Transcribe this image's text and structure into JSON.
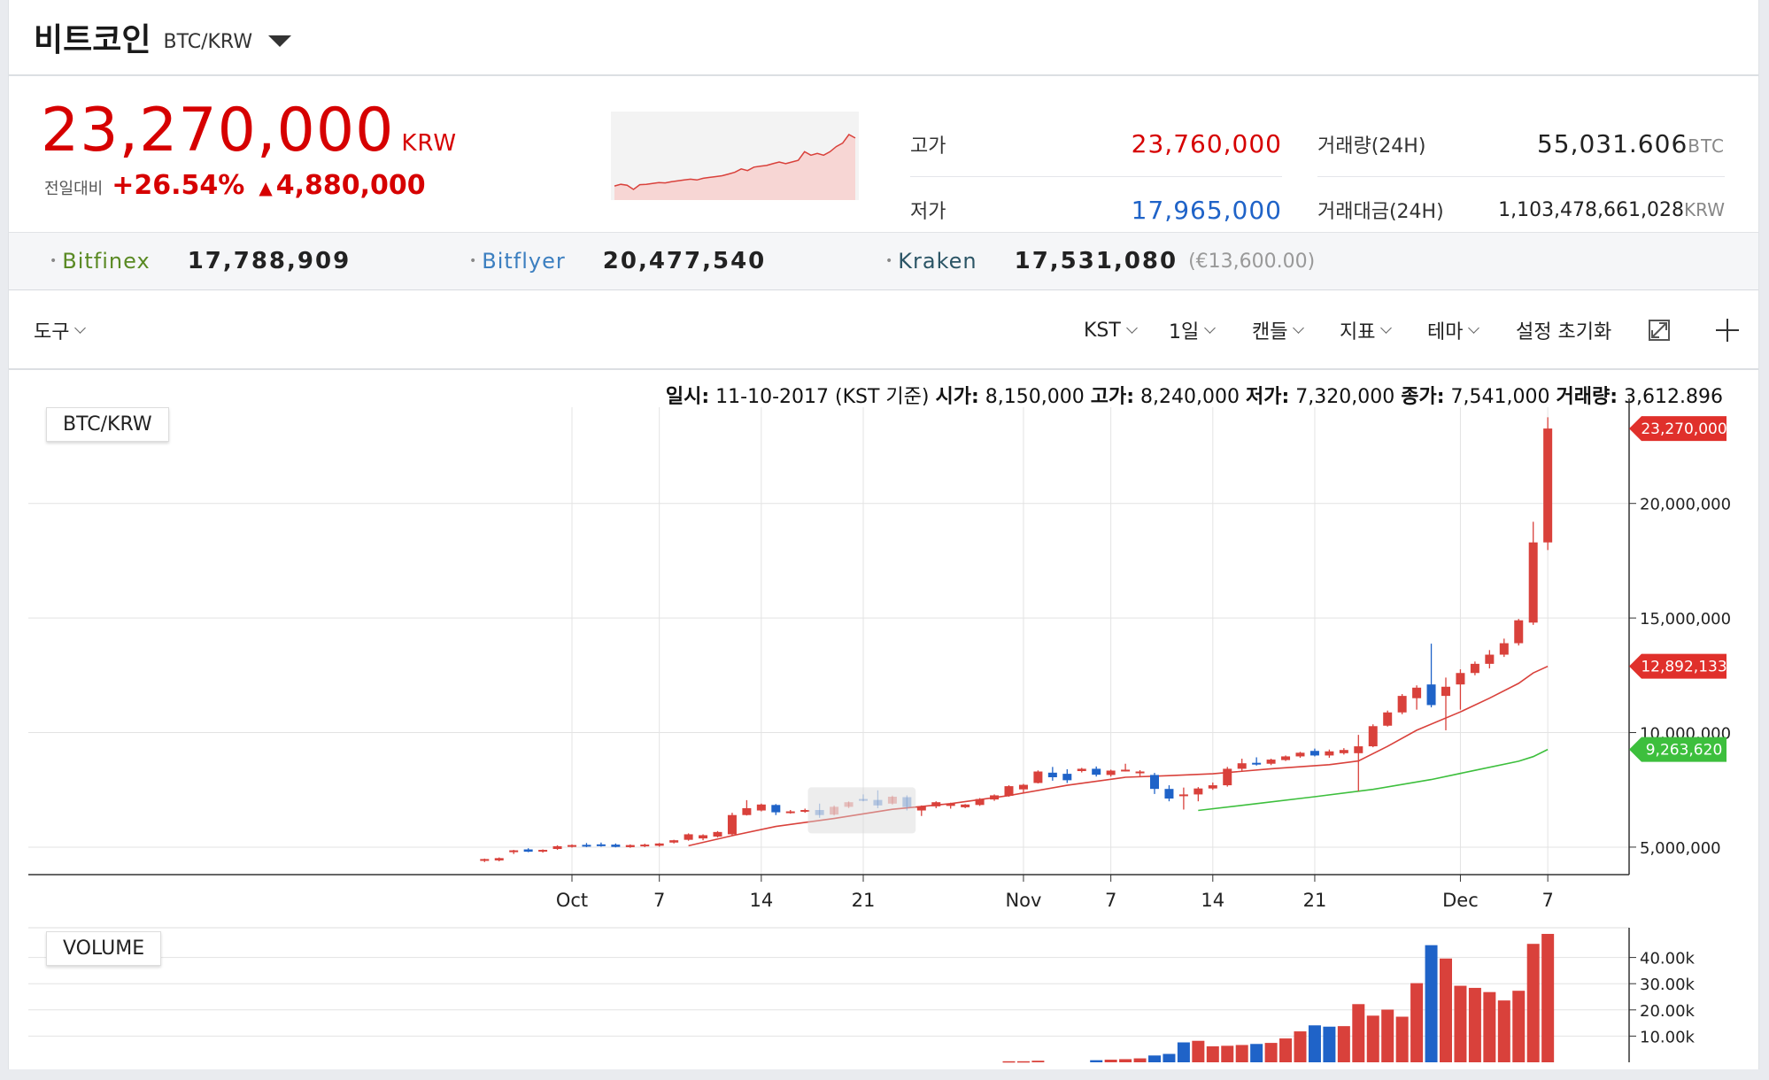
{
  "header": {
    "coin_name": "비트코인",
    "pair": "BTC/KRW"
  },
  "summary": {
    "price": "23,270,000",
    "price_unit": "KRW",
    "change_label": "전일대비",
    "change_pct": "+26.54%",
    "change_abs": "4,880,000",
    "high_label": "고가",
    "high_value": "23,760,000",
    "low_label": "저가",
    "low_value": "17,965,000",
    "volume_label": "거래량(24H)",
    "volume_value": "55,031.606",
    "volume_unit": "BTC",
    "amount_label": "거래대금(24H)",
    "amount_value": "1,103,478,661,028",
    "amount_unit": "KRW"
  },
  "exchanges": [
    {
      "name": "Bitfinex",
      "price": "17,788,909",
      "color": "#5a8a24",
      "extra": ""
    },
    {
      "name": "Bitflyer",
      "price": "20,477,540",
      "color": "#3c7fc0",
      "extra": ""
    },
    {
      "name": "Kraken",
      "price": "17,531,080",
      "color": "#2b5566",
      "extra": "(€13,600.00)"
    }
  ],
  "toolbar": {
    "tools": "도구",
    "timezone": "KST",
    "interval": "1일",
    "candle": "캔들",
    "indicator": "지표",
    "theme": "테마",
    "reset": "설정 초기화"
  },
  "info_line": {
    "date_label": "일시:",
    "date_value": "11-10-2017 (KST 기준)",
    "open_label": "시가:",
    "open_value": "8,150,000",
    "high_label": "고가:",
    "high_value": "8,240,000",
    "low_label": "저가:",
    "low_value": "7,320,000",
    "close_label": "종가:",
    "close_value": "7,541,000",
    "vol_label": "거래량:",
    "vol_value": "3,612.896"
  },
  "panels": {
    "price_label": "BTC/KRW",
    "volume_label": "VOLUME"
  },
  "colors": {
    "up": "#d9413b",
    "down": "#1f63c8",
    "ma_short": "#d9413b",
    "ma_long": "#3dbf3d",
    "price_red": "#d60000",
    "low_blue": "#1f63c8"
  },
  "chart_data": {
    "type": "candlestick",
    "ylim": [
      3800000,
      24200000
    ],
    "y_ticks": [
      5000000,
      10000000,
      15000000,
      20000000
    ],
    "y_tick_labels": [
      "5,000,000",
      "10,000,000",
      "15,000,000",
      "20,000,000"
    ],
    "x_ticks": [
      {
        "day": 0,
        "label": "Oct"
      },
      {
        "day": 6,
        "label": "7"
      },
      {
        "day": 13,
        "label": "14"
      },
      {
        "day": 20,
        "label": "21"
      },
      {
        "day": 31,
        "label": "Nov"
      },
      {
        "day": 37,
        "label": "7"
      },
      {
        "day": 44,
        "label": "14"
      },
      {
        "day": 51,
        "label": "21"
      },
      {
        "day": 61,
        "label": "Dec"
      },
      {
        "day": 67,
        "label": "7"
      }
    ],
    "price_markers": [
      {
        "label": "23,270,000",
        "value": 23270000,
        "color": "#e0302b"
      },
      {
        "label": "12,892,133",
        "value": 12892133,
        "color": "#e0302b"
      },
      {
        "label": "9,263,620",
        "value": 9263620,
        "color": "#3dbf3d"
      }
    ],
    "candles": [
      {
        "day": -6,
        "o": 4400000,
        "h": 4500000,
        "l": 4350000,
        "c": 4480000
      },
      {
        "day": -5,
        "o": 4420000,
        "h": 4550000,
        "l": 4380000,
        "c": 4520000
      },
      {
        "day": -4,
        "o": 4780000,
        "h": 4880000,
        "l": 4700000,
        "c": 4860000
      },
      {
        "day": -3,
        "o": 4900000,
        "h": 4950000,
        "l": 4780000,
        "c": 4800000
      },
      {
        "day": -2,
        "o": 4820000,
        "h": 4900000,
        "l": 4760000,
        "c": 4880000
      },
      {
        "day": -1,
        "o": 4920000,
        "h": 5080000,
        "l": 4880000,
        "c": 5040000
      },
      {
        "day": 0,
        "o": 5020000,
        "h": 5120000,
        "l": 4980000,
        "c": 5090000
      },
      {
        "day": 1,
        "o": 5100000,
        "h": 5180000,
        "l": 5000000,
        "c": 5040000
      },
      {
        "day": 2,
        "o": 5120000,
        "h": 5200000,
        "l": 5020000,
        "c": 5050000
      },
      {
        "day": 3,
        "o": 5110000,
        "h": 5160000,
        "l": 4990000,
        "c": 5010000
      },
      {
        "day": 4,
        "o": 5000000,
        "h": 5120000,
        "l": 4970000,
        "c": 5090000
      },
      {
        "day": 5,
        "o": 5050000,
        "h": 5150000,
        "l": 5000000,
        "c": 5110000
      },
      {
        "day": 6,
        "o": 5060000,
        "h": 5180000,
        "l": 5020000,
        "c": 5160000
      },
      {
        "day": 7,
        "o": 5200000,
        "h": 5320000,
        "l": 5160000,
        "c": 5300000
      },
      {
        "day": 8,
        "o": 5320000,
        "h": 5600000,
        "l": 5280000,
        "c": 5560000
      },
      {
        "day": 9,
        "o": 5380000,
        "h": 5560000,
        "l": 5300000,
        "c": 5520000
      },
      {
        "day": 10,
        "o": 5460000,
        "h": 5700000,
        "l": 5420000,
        "c": 5660000
      },
      {
        "day": 11,
        "o": 5560000,
        "h": 6500000,
        "l": 5520000,
        "c": 6400000
      },
      {
        "day": 12,
        "o": 6400000,
        "h": 7050000,
        "l": 6380000,
        "c": 6700000
      },
      {
        "day": 13,
        "o": 6600000,
        "h": 6900000,
        "l": 6560000,
        "c": 6860000
      },
      {
        "day": 14,
        "o": 6840000,
        "h": 6880000,
        "l": 6400000,
        "c": 6520000
      }
    ],
    "candles_faded_start_day": 15,
    "candles_2": [
      {
        "day": 15,
        "o": 6520000,
        "h": 6620000,
        "l": 6460000,
        "c": 6560000
      },
      {
        "day": 16,
        "o": 6560000,
        "h": 6680000,
        "l": 6500000,
        "c": 6620000
      },
      {
        "day": 17,
        "o": 6620000,
        "h": 6900000,
        "l": 6280000,
        "c": 6400000
      },
      {
        "day": 18,
        "o": 6420000,
        "h": 6820000,
        "l": 6380000,
        "c": 6760000
      },
      {
        "day": 19,
        "o": 6760000,
        "h": 7000000,
        "l": 6700000,
        "c": 6960000
      },
      {
        "day": 20,
        "o": 7100000,
        "h": 7300000,
        "l": 7000000,
        "c": 7050000
      },
      {
        "day": 21,
        "o": 7060000,
        "h": 7480000,
        "l": 6700000,
        "c": 6820000
      },
      {
        "day": 22,
        "o": 6900000,
        "h": 7250000,
        "l": 6850000,
        "c": 7200000
      },
      {
        "day": 23,
        "o": 7180000,
        "h": 7260000,
        "l": 6600000,
        "c": 6750000
      },
      {
        "day": 24,
        "o": 6600000,
        "h": 6820000,
        "l": 6360000,
        "c": 6780000
      },
      {
        "day": 25,
        "o": 6780000,
        "h": 7000000,
        "l": 6700000,
        "c": 6960000
      },
      {
        "day": 26,
        "o": 6800000,
        "h": 6940000,
        "l": 6680000,
        "c": 6900000
      },
      {
        "day": 27,
        "o": 6740000,
        "h": 6880000,
        "l": 6700000,
        "c": 6860000
      },
      {
        "day": 28,
        "o": 6840000,
        "h": 7140000,
        "l": 6800000,
        "c": 7100000
      },
      {
        "day": 29,
        "o": 7080000,
        "h": 7300000,
        "l": 7020000,
        "c": 7260000
      },
      {
        "day": 30,
        "o": 7240000,
        "h": 7700000,
        "l": 7200000,
        "c": 7660000
      },
      {
        "day": 31,
        "o": 7520000,
        "h": 7760000,
        "l": 7380000,
        "c": 7720000
      },
      {
        "day": 32,
        "o": 7800000,
        "h": 8350000,
        "l": 7780000,
        "c": 8300000
      },
      {
        "day": 33,
        "o": 8250000,
        "h": 8500000,
        "l": 7900000,
        "c": 8050000
      },
      {
        "day": 34,
        "o": 8200000,
        "h": 8400000,
        "l": 7800000,
        "c": 7920000
      },
      {
        "day": 35,
        "o": 8320000,
        "h": 8460000,
        "l": 8260000,
        "c": 8420000
      },
      {
        "day": 36,
        "o": 8420000,
        "h": 8520000,
        "l": 8080000,
        "c": 8160000
      },
      {
        "day": 37,
        "o": 8150000,
        "h": 8380000,
        "l": 8080000,
        "c": 8340000
      },
      {
        "day": 38,
        "o": 8340000,
        "h": 8640000,
        "l": 8300000,
        "c": 8380000
      },
      {
        "day": 39,
        "o": 8260000,
        "h": 8360000,
        "l": 8100000,
        "c": 8300000
      },
      {
        "day": 40,
        "o": 8150000,
        "h": 8240000,
        "l": 7320000,
        "c": 7541000
      },
      {
        "day": 41,
        "o": 7540000,
        "h": 7700000,
        "l": 7000000,
        "c": 7120000
      },
      {
        "day": 42,
        "o": 7300000,
        "h": 7600000,
        "l": 6640000,
        "c": 7300000
      },
      {
        "day": 43,
        "o": 7300000,
        "h": 7620000,
        "l": 7000000,
        "c": 7560000
      },
      {
        "day": 44,
        "o": 7560000,
        "h": 7820000,
        "l": 7500000,
        "c": 7700000
      },
      {
        "day": 45,
        "o": 7700000,
        "h": 8500000,
        "l": 7640000,
        "c": 8420000
      },
      {
        "day": 46,
        "o": 8420000,
        "h": 8860000,
        "l": 8340000,
        "c": 8660000
      },
      {
        "day": 47,
        "o": 8680000,
        "h": 8920000,
        "l": 8560000,
        "c": 8640000
      },
      {
        "day": 48,
        "o": 8640000,
        "h": 8860000,
        "l": 8580000,
        "c": 8820000
      },
      {
        "day": 49,
        "o": 8800000,
        "h": 9000000,
        "l": 8760000,
        "c": 8960000
      },
      {
        "day": 50,
        "o": 8960000,
        "h": 9160000,
        "l": 8900000,
        "c": 9120000
      },
      {
        "day": 51,
        "o": 9200000,
        "h": 9300000,
        "l": 8960000,
        "c": 9000000
      },
      {
        "day": 52,
        "o": 9000000,
        "h": 9260000,
        "l": 8900000,
        "c": 9180000
      },
      {
        "day": 53,
        "o": 9100000,
        "h": 9320000,
        "l": 9040000,
        "c": 9240000
      },
      {
        "day": 54,
        "o": 9100000,
        "h": 9900000,
        "l": 7440000,
        "c": 9400000
      },
      {
        "day": 55,
        "o": 9400000,
        "h": 10360000,
        "l": 9360000,
        "c": 10280000
      },
      {
        "day": 56,
        "o": 10300000,
        "h": 10960000,
        "l": 10260000,
        "c": 10880000
      },
      {
        "day": 57,
        "o": 10880000,
        "h": 11680000,
        "l": 10800000,
        "c": 11600000
      },
      {
        "day": 58,
        "o": 11500000,
        "h": 12060000,
        "l": 11000000,
        "c": 11960000
      },
      {
        "day": 59,
        "o": 12100000,
        "h": 13880000,
        "l": 11100000,
        "c": 11200000
      },
      {
        "day": 60,
        "o": 11600000,
        "h": 12400000,
        "l": 10100000,
        "c": 12000000
      },
      {
        "day": 61,
        "o": 12100000,
        "h": 12760000,
        "l": 11000000,
        "c": 12600000
      },
      {
        "day": 62,
        "o": 12600000,
        "h": 13100000,
        "l": 12500000,
        "c": 13000000
      },
      {
        "day": 63,
        "o": 13000000,
        "h": 13600000,
        "l": 12800000,
        "c": 13400000
      },
      {
        "day": 64,
        "o": 13400000,
        "h": 14100000,
        "l": 13300000,
        "c": 13900000
      },
      {
        "day": 65,
        "o": 13900000,
        "h": 14960000,
        "l": 13800000,
        "c": 14900000
      },
      {
        "day": 66,
        "o": 14800000,
        "h": 19200000,
        "l": 14700000,
        "c": 18300000
      },
      {
        "day": 67,
        "o": 18300000,
        "h": 23760000,
        "l": 17965000,
        "c": 23270000
      }
    ],
    "ma_short": [
      [
        8,
        5060000
      ],
      [
        11,
        5500000
      ],
      [
        14,
        5900000
      ],
      [
        18,
        6250000
      ],
      [
        22,
        6650000
      ],
      [
        26,
        6900000
      ],
      [
        30,
        7250000
      ],
      [
        34,
        7700000
      ],
      [
        38,
        8050000
      ],
      [
        41,
        8120000
      ],
      [
        44,
        8200000
      ],
      [
        48,
        8420000
      ],
      [
        52,
        8600000
      ],
      [
        54,
        8760000
      ],
      [
        56,
        9400000
      ],
      [
        58,
        10100000
      ],
      [
        61,
        10900000
      ],
      [
        63,
        11500000
      ],
      [
        65,
        12150000
      ],
      [
        66,
        12600000
      ],
      [
        67,
        12892133
      ]
    ],
    "ma_long": [
      [
        43,
        6600000
      ],
      [
        47,
        6900000
      ],
      [
        51,
        7200000
      ],
      [
        55,
        7520000
      ],
      [
        59,
        7950000
      ],
      [
        62,
        8350000
      ],
      [
        65,
        8750000
      ],
      [
        66,
        8950000
      ],
      [
        67,
        9263620
      ]
    ],
    "volume": {
      "ylim": [
        0,
        50000
      ],
      "y_ticks": [
        10000,
        20000,
        30000,
        40000
      ],
      "y_tick_labels": [
        "10.00k",
        "20.00k",
        "30.00k",
        "40.00k"
      ],
      "bars": [
        {
          "day": 30,
          "v": 400,
          "up": true
        },
        {
          "day": 31,
          "v": 400,
          "up": true
        },
        {
          "day": 32,
          "v": 600,
          "up": true
        },
        {
          "day": 36,
          "v": 800,
          "up": false
        },
        {
          "day": 37,
          "v": 1000,
          "up": true
        },
        {
          "day": 38,
          "v": 1200,
          "up": true
        },
        {
          "day": 39,
          "v": 1500,
          "up": true
        },
        {
          "day": 40,
          "v": 2600,
          "up": false
        },
        {
          "day": 41,
          "v": 3200,
          "up": false
        },
        {
          "day": 42,
          "v": 7600,
          "up": false
        },
        {
          "day": 43,
          "v": 8200,
          "up": true
        },
        {
          "day": 44,
          "v": 6100,
          "up": true
        },
        {
          "day": 45,
          "v": 6300,
          "up": true
        },
        {
          "day": 46,
          "v": 6600,
          "up": true
        },
        {
          "day": 47,
          "v": 7000,
          "up": false
        },
        {
          "day": 48,
          "v": 7400,
          "up": true
        },
        {
          "day": 49,
          "v": 9100,
          "up": true
        },
        {
          "day": 50,
          "v": 11800,
          "up": true
        },
        {
          "day": 51,
          "v": 14100,
          "up": false
        },
        {
          "day": 52,
          "v": 13600,
          "up": false
        },
        {
          "day": 53,
          "v": 13800,
          "up": true
        },
        {
          "day": 54,
          "v": 22200,
          "up": true
        },
        {
          "day": 55,
          "v": 17800,
          "up": true
        },
        {
          "day": 56,
          "v": 20100,
          "up": true
        },
        {
          "day": 57,
          "v": 17400,
          "up": true
        },
        {
          "day": 58,
          "v": 30200,
          "up": true
        },
        {
          "day": 59,
          "v": 44700,
          "up": false
        },
        {
          "day": 60,
          "v": 39600,
          "up": true
        },
        {
          "day": 61,
          "v": 29200,
          "up": true
        },
        {
          "day": 62,
          "v": 28400,
          "up": true
        },
        {
          "day": 63,
          "v": 26800,
          "up": true
        },
        {
          "day": 64,
          "v": 23600,
          "up": true
        },
        {
          "day": 65,
          "v": 27300,
          "up": true
        },
        {
          "day": 66,
          "v": 45200,
          "up": true
        },
        {
          "day": 67,
          "v": 49000,
          "up": true
        }
      ]
    },
    "sparkline": [
      1.2,
      1.3,
      1.25,
      1.0,
      1.28,
      1.3,
      1.35,
      1.4,
      1.38,
      1.45,
      1.5,
      1.55,
      1.6,
      1.55,
      1.65,
      1.7,
      1.75,
      1.8,
      1.9,
      2.0,
      2.2,
      2.1,
      2.3,
      2.35,
      2.4,
      2.5,
      2.6,
      2.5,
      2.6,
      2.7,
      3.2,
      3.0,
      3.1,
      3.0,
      3.2,
      3.5,
      3.7,
      4.2,
      4.0
    ]
  }
}
